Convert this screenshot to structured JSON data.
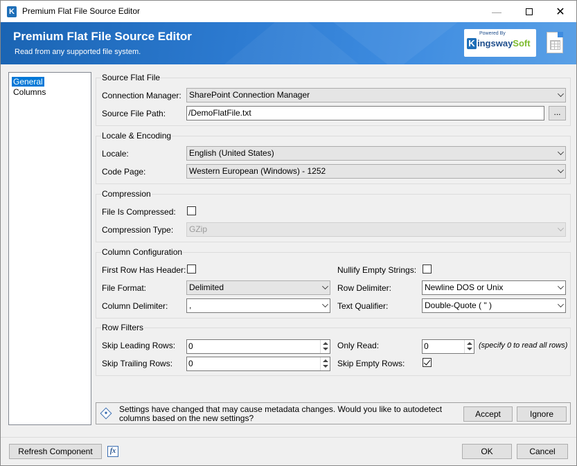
{
  "window": {
    "title": "Premium Flat File Source Editor",
    "app_icon": "K",
    "controls": {
      "minimize": "—",
      "close": "✕"
    }
  },
  "header": {
    "title": "Premium Flat File Source Editor",
    "subtitle": "Read from any supported file system.",
    "logo": {
      "powered_by": "Powered By",
      "k": "K",
      "name_part1": "ingsway",
      "name_part2": "Soft"
    },
    "accent_color": "#2c7ad0"
  },
  "nav": {
    "items": [
      {
        "label": "General",
        "selected": true
      },
      {
        "label": "Columns",
        "selected": false
      }
    ]
  },
  "source": {
    "title": "Source Flat File",
    "connection_manager_label": "Connection Manager:",
    "connection_manager_value": "SharePoint Connection Manager",
    "file_path_label": "Source File Path:",
    "file_path_value": "/DemoFlatFile.txt",
    "browse_label": "..."
  },
  "locale": {
    "title": "Locale & Encoding",
    "locale_label": "Locale:",
    "locale_value": "English (United States)",
    "code_page_label": "Code Page:",
    "code_page_value": "Western European (Windows) - 1252"
  },
  "compression": {
    "title": "Compression",
    "is_compressed_label": "File Is Compressed:",
    "is_compressed": false,
    "type_label": "Compression Type:",
    "type_value": "GZip"
  },
  "columns": {
    "title": "Column Configuration",
    "first_row_header_label": "First Row Has Header:",
    "first_row_header": false,
    "nullify_label": "Nullify Empty Strings:",
    "nullify": false,
    "file_format_label": "File Format:",
    "file_format_value": "Delimited",
    "row_delimiter_label": "Row Delimiter:",
    "row_delimiter_value": "Newline DOS or Unix",
    "column_delimiter_label": "Column Delimiter:",
    "column_delimiter_value": ",",
    "text_qualifier_label": "Text Qualifier:",
    "text_qualifier_value": "Double-Quote ( \" )"
  },
  "filters": {
    "title": "Row Filters",
    "skip_leading_label": "Skip Leading Rows:",
    "skip_leading_value": "0",
    "only_read_label": "Only Read:",
    "only_read_value": "0",
    "only_read_hint": "(specify 0 to read all rows)",
    "skip_trailing_label": "Skip Trailing Rows:",
    "skip_trailing_value": "0",
    "skip_empty_label": "Skip Empty Rows:",
    "skip_empty": true
  },
  "notice": {
    "text": "Settings have changed that may cause metadata changes. Would you like to autodetect columns based on the new settings?",
    "accept_label": "Accept",
    "ignore_label": "Ignore"
  },
  "footer": {
    "refresh_label": "Refresh Component",
    "fx_label": "fx",
    "ok_label": "OK",
    "cancel_label": "Cancel"
  }
}
